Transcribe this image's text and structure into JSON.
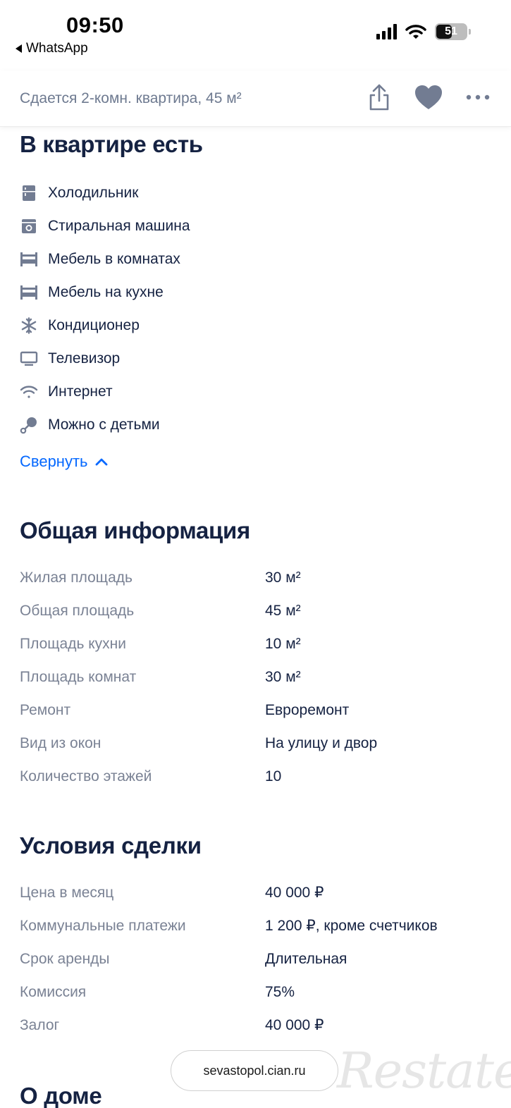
{
  "status_bar": {
    "time": "09:50",
    "back_app": "WhatsApp",
    "battery_level": "51",
    "icons": [
      "signal-icon",
      "wifi-icon",
      "battery-icon"
    ]
  },
  "header": {
    "title": "Сдается 2-комн. квартира, 45 м²",
    "actions": [
      "share-icon",
      "heart-icon",
      "more-icon"
    ]
  },
  "amenities": {
    "title": "В квартире есть",
    "items": [
      {
        "label": "Холодильник",
        "icon": "fridge-icon"
      },
      {
        "label": "Стиральная машина",
        "icon": "washing-machine-icon"
      },
      {
        "label": "Мебель в комнатах",
        "icon": "bed-icon"
      },
      {
        "label": "Мебель на кухне",
        "icon": "bed-icon"
      },
      {
        "label": "Кондиционер",
        "icon": "snowflake-icon"
      },
      {
        "label": "Телевизор",
        "icon": "tv-icon"
      },
      {
        "label": "Интернет",
        "icon": "wifi-icon"
      },
      {
        "label": "Можно с детьми",
        "icon": "baby-rattle-icon"
      }
    ],
    "collapse_label": "Свернуть"
  },
  "general_info": {
    "title": "Общая информация",
    "rows": [
      {
        "label": "Жилая площадь",
        "value": "30 м²"
      },
      {
        "label": "Общая площадь",
        "value": "45 м²"
      },
      {
        "label": "Площадь кухни",
        "value": "10 м²"
      },
      {
        "label": "Площадь комнат",
        "value": "30 м²"
      },
      {
        "label": "Ремонт",
        "value": "Евроремонт"
      },
      {
        "label": "Вид из окон",
        "value": "На улицу и двор"
      },
      {
        "label": "Количество этажей",
        "value": "10"
      }
    ]
  },
  "deal_terms": {
    "title": "Условия сделки",
    "rows": [
      {
        "label": "Цена в месяц",
        "value": "40 000 ₽"
      },
      {
        "label": "Коммунальные платежи",
        "value": "1 200 ₽, кроме счетчиков"
      },
      {
        "label": "Срок аренды",
        "value": "Длительная"
      },
      {
        "label": "Комиссия",
        "value": "75%"
      },
      {
        "label": "Залог",
        "value": "40 000 ₽"
      }
    ]
  },
  "house": {
    "title": "О доме"
  },
  "browser": {
    "url": "sevastopol.cian.ru"
  },
  "watermark": {
    "text": "Restate"
  },
  "colors": {
    "text_primary": "#152242",
    "text_secondary": "#7a8294",
    "link": "#0468ff",
    "icon": "#727c92"
  }
}
